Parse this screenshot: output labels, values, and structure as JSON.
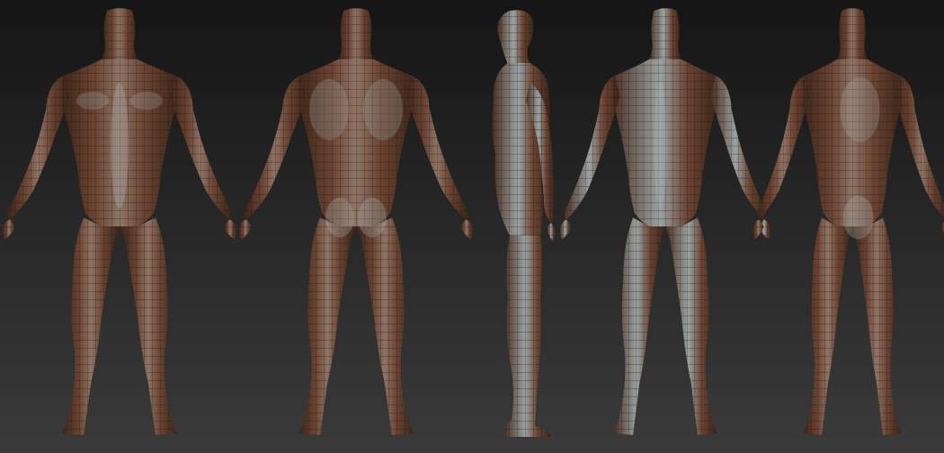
{
  "scene": {
    "views": [
      {
        "id": "front",
        "icon": "figure-front-view-icon"
      },
      {
        "id": "back",
        "icon": "figure-back-view-icon"
      },
      {
        "id": "side",
        "icon": "figure-side-view-icon"
      },
      {
        "id": "three-quarter-front",
        "icon": "figure-three-quarter-front-icon"
      },
      {
        "id": "three-quarter-back",
        "icon": "figure-three-quarter-back-icon"
      }
    ],
    "colors": {
      "background_top": "#141414",
      "background_bottom": "#3a3a3a",
      "skin_dark": "#3b2418",
      "skin_mid": "#6b4433",
      "skin_light": "#8f7466",
      "highlight": "#a9b2b2",
      "wire": "#1e120c"
    }
  }
}
